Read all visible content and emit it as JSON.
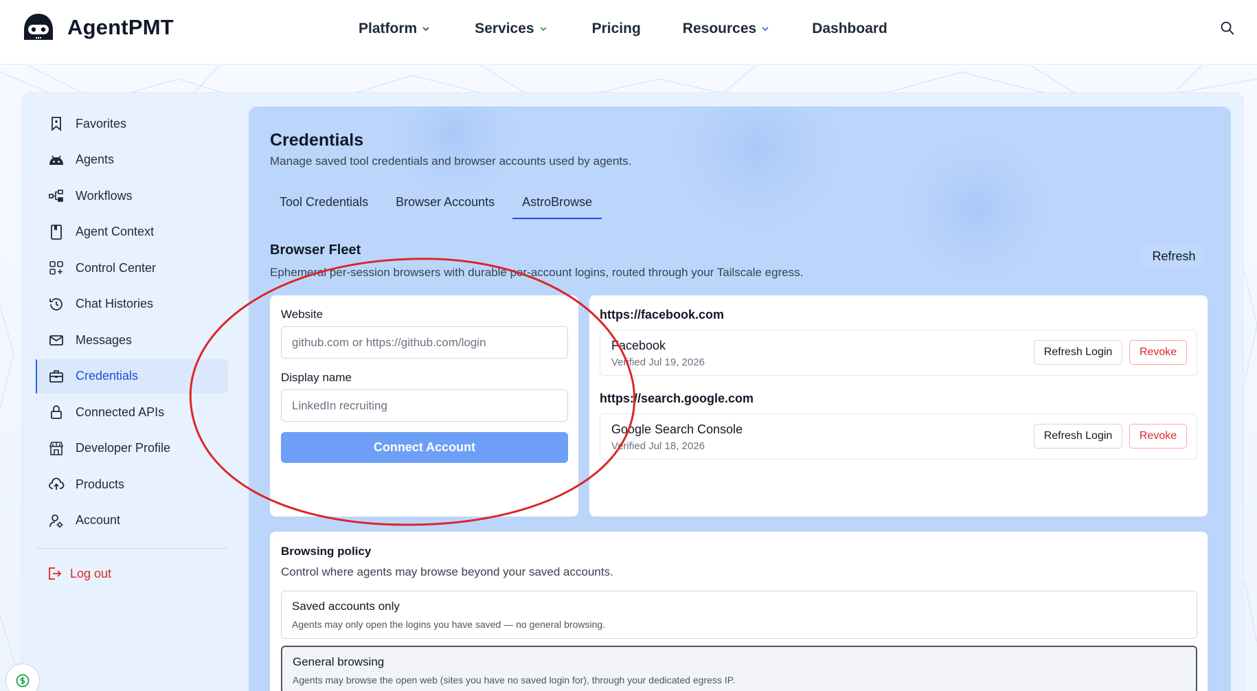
{
  "brand": {
    "name": "AgentPMT"
  },
  "nav": {
    "items": [
      {
        "label": "Platform",
        "has_menu": true
      },
      {
        "label": "Services",
        "has_menu": true
      },
      {
        "label": "Pricing",
        "has_menu": false
      },
      {
        "label": "Resources",
        "has_menu": true
      },
      {
        "label": "Dashboard",
        "has_menu": false
      }
    ]
  },
  "sidebar": {
    "items": [
      {
        "label": "Favorites",
        "icon": "bookmark-icon"
      },
      {
        "label": "Agents",
        "icon": "robot-icon"
      },
      {
        "label": "Workflows",
        "icon": "workflow-icon"
      },
      {
        "label": "Agent Context",
        "icon": "book-icon"
      },
      {
        "label": "Control Center",
        "icon": "grid-plus-icon"
      },
      {
        "label": "Chat Histories",
        "icon": "history-icon"
      },
      {
        "label": "Messages",
        "icon": "mail-icon"
      },
      {
        "label": "Credentials",
        "icon": "briefcase-icon",
        "active": true
      },
      {
        "label": "Connected APIs",
        "icon": "lock-icon"
      },
      {
        "label": "Developer Profile",
        "icon": "store-icon"
      },
      {
        "label": "Products",
        "icon": "cloud-upload-icon"
      },
      {
        "label": "Account",
        "icon": "user-gear-icon"
      }
    ],
    "logout": "Log out"
  },
  "page": {
    "title": "Credentials",
    "subtitle": "Manage saved tool credentials and browser accounts used by agents.",
    "tabs": [
      {
        "label": "Tool Credentials"
      },
      {
        "label": "Browser Accounts"
      },
      {
        "label": "AstroBrowse",
        "active": true
      }
    ]
  },
  "fleet": {
    "title": "Browser Fleet",
    "subtitle": "Ephemeral per-session browsers with durable per-account logins, routed through your Tailscale egress.",
    "refresh_label": "Refresh",
    "form": {
      "website_label": "Website",
      "website_placeholder": "github.com or https://github.com/login",
      "display_label": "Display name",
      "display_placeholder": "LinkedIn recruiting",
      "connect_label": "Connect Account"
    },
    "sites": [
      {
        "url": "https://facebook.com",
        "account": {
          "name": "Facebook",
          "verified": "Verified Jul 19, 2026"
        }
      },
      {
        "url": "https://search.google.com",
        "account": {
          "name": "Google Search Console",
          "verified": "Verified Jul 18, 2026"
        }
      }
    ],
    "refresh_login_label": "Refresh Login",
    "revoke_label": "Revoke"
  },
  "policy": {
    "title": "Browsing policy",
    "subtitle": "Control where agents may browse beyond your saved accounts.",
    "options": [
      {
        "title": "Saved accounts only",
        "desc": "Agents may only open the logins you have saved — no general browsing."
      },
      {
        "title": "General browsing",
        "desc": "Agents may browse the open web (sites you have no saved login for), through your dedicated egress IP.",
        "selected": true
      }
    ]
  },
  "colors": {
    "accent": "#1d4ed8",
    "primary_button": "#6e9ff6",
    "danger": "#dc2626",
    "annotation": "#dc2626",
    "panel": "#bcd6fb"
  }
}
